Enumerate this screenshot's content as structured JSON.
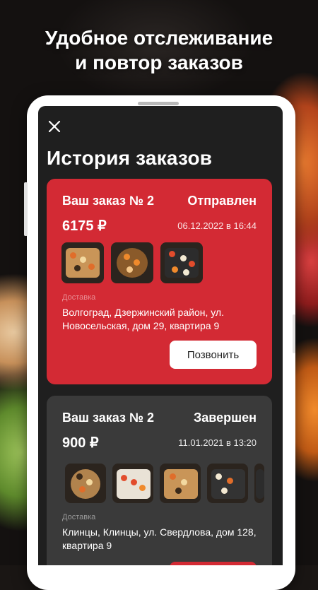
{
  "headline": {
    "line1": "Удобное отслеживание",
    "line2": "и повтор заказов"
  },
  "screen": {
    "close_icon": "close-icon",
    "title": "История заказов"
  },
  "orders": [
    {
      "number": "Ваш заказ № 2",
      "status": "Отправлен",
      "price": "6175 ₽",
      "date": "06.12.2022 в 16:44",
      "delivery_label": "Доставка",
      "address": "Волгоград, Дзержинский район, ул. Новосельская, дом 29, квартира 9",
      "call_label": "Позвонить",
      "color": "#d32a34"
    },
    {
      "number": "Ваш заказ № 2",
      "status": "Завершен",
      "price": "900 ₽",
      "date": "11.01.2021 в 13:20",
      "delivery_label": "Доставка",
      "address": "Клинцы, Клинцы, ул. Свердлова, дом 128, квартира 9",
      "color": "#3a3a3a"
    }
  ]
}
